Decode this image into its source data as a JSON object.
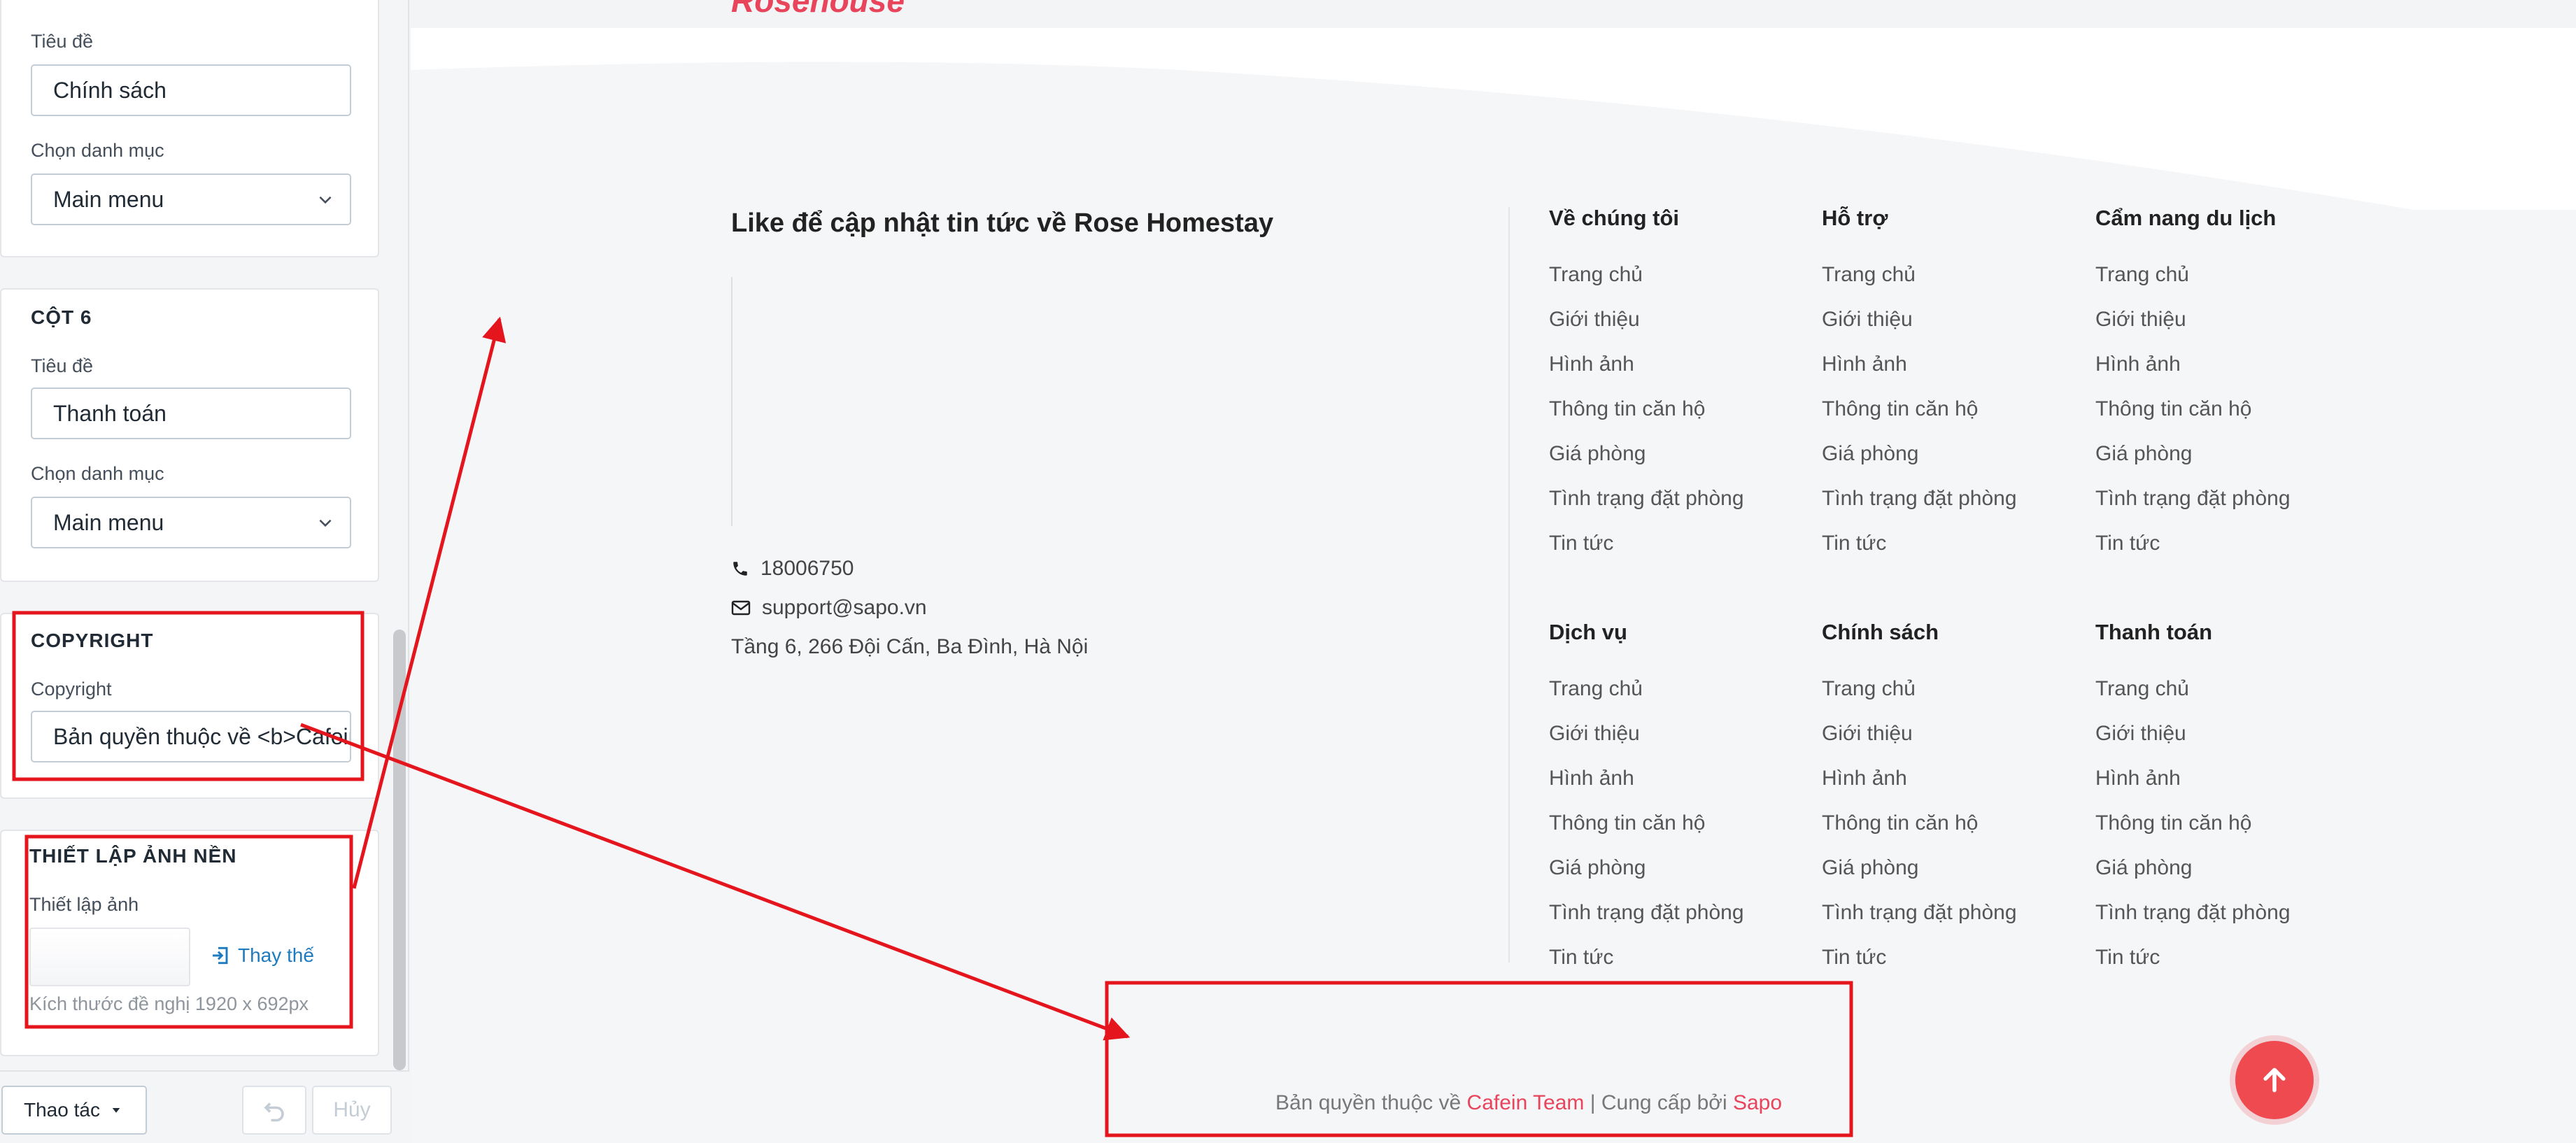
{
  "panel": {
    "col5": {
      "title_label": "Tiêu đề",
      "title_value": "Chính sách",
      "category_label": "Chọn danh mục",
      "category_value": "Main menu"
    },
    "col6": {
      "heading": "CỘT 6",
      "title_label": "Tiêu đề",
      "title_value": "Thanh toán",
      "category_label": "Chọn danh mục",
      "category_value": "Main menu"
    },
    "copyright": {
      "heading": "COPYRIGHT",
      "label": "Copyright",
      "value": "Bản quyền thuộc về <b>Cafein Team</b>"
    },
    "background": {
      "heading": "THIẾT LẬP ẢNH NỀN",
      "label": "Thiết lập ảnh",
      "replace": "Thay thế",
      "hint": "Kích thước đề nghị 1920 x 692px"
    },
    "bottom": {
      "action": "Thao tác",
      "redo": "Hủy"
    }
  },
  "preview": {
    "logo_text": "Rosehouse",
    "like_title": "Like để cập nhật tin tức về Rose Homestay",
    "contact": {
      "phone": "18006750",
      "email": "support@sapo.vn",
      "address": "Tầng 6, 266 Đội Cấn, Ba Đình, Hà Nội"
    },
    "columns": [
      {
        "heading": "Về chúng tôi",
        "items": [
          "Trang chủ",
          "Giới thiệu",
          "Hình ảnh",
          "Thông tin căn hộ",
          "Giá phòng",
          "Tình trạng đặt phòng",
          "Tin tức"
        ]
      },
      {
        "heading": "Hỗ trợ",
        "items": [
          "Trang chủ",
          "Giới thiệu",
          "Hình ảnh",
          "Thông tin căn hộ",
          "Giá phòng",
          "Tình trạng đặt phòng",
          "Tin tức"
        ]
      },
      {
        "heading": "Cẩm nang du lịch",
        "items": [
          "Trang chủ",
          "Giới thiệu",
          "Hình ảnh",
          "Thông tin căn hộ",
          "Giá phòng",
          "Tình trạng đặt phòng",
          "Tin tức"
        ]
      },
      {
        "heading": "Dịch vụ",
        "items": [
          "Trang chủ",
          "Giới thiệu",
          "Hình ảnh",
          "Thông tin căn hộ",
          "Giá phòng",
          "Tình trạng đặt phòng",
          "Tin tức"
        ]
      },
      {
        "heading": "Chính sách",
        "items": [
          "Trang chủ",
          "Giới thiệu",
          "Hình ảnh",
          "Thông tin căn hộ",
          "Giá phòng",
          "Tình trạng đặt phòng",
          "Tin tức"
        ]
      },
      {
        "heading": "Thanh toán",
        "items": [
          "Trang chủ",
          "Giới thiệu",
          "Hình ảnh",
          "Thông tin căn hộ",
          "Giá phòng",
          "Tình trạng đặt phòng",
          "Tin tức"
        ]
      }
    ],
    "copyright": {
      "prefix": "Bản quyền thuộc về ",
      "team": "Cafein Team",
      "middle": " | Cung cấp bởi ",
      "provider": "Sapo"
    }
  },
  "colors": {
    "accent_red": "#e8445b",
    "annotation_red": "#e4151c",
    "link_blue": "#1f7bc0"
  },
  "icons": [
    "phone-icon",
    "mail-icon",
    "chevron-down-icon",
    "replace-icon",
    "undo-icon",
    "caret-down-icon",
    "arrow-up-icon"
  ]
}
